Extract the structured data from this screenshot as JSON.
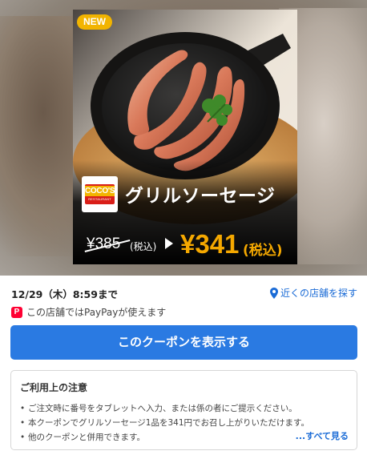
{
  "coupon": {
    "badge": "NEW",
    "brand_logo_text": "COCO'S",
    "brand_logo_sub": "RESTAURANT",
    "item_name": "グリルソーセージ",
    "old_price": "¥385",
    "old_price_tax": "(税込)",
    "new_price": "¥341",
    "new_price_tax": "(税込)",
    "colors": {
      "accent": "#f5a800",
      "badge": "#f2b400",
      "logo_red": "#d91e18"
    }
  },
  "info": {
    "expiry": "12/29（木）8:59まで",
    "nearby_link": "近くの店舗を探す",
    "paypay_icon": "P",
    "paypay_text": "この店舗ではPayPayが使えます"
  },
  "cta": {
    "label": "このクーポンを表示する",
    "color": "#2a7ae2"
  },
  "notice": {
    "title": "ご利用上の注意",
    "items": [
      "ご注文時に番号をタブレットへ入力、または係の者にご提示ください。",
      "本クーポンでグリルソーセージ1品を341円でお召し上がりいただけます。",
      "他のクーポンと併用できます。"
    ],
    "see_all": "...すべて見る"
  },
  "icons": [
    "location-pin-icon",
    "paypay-icon",
    "arrow-right-icon"
  ]
}
